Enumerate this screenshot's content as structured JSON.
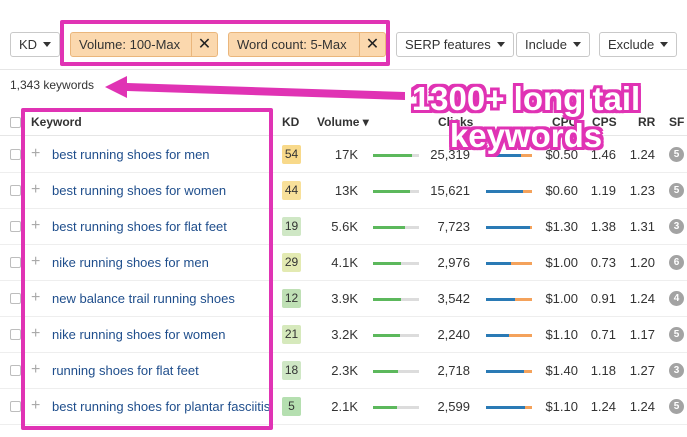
{
  "filters": {
    "kd_label": "KD",
    "chip_volume": "Volume: 100-Max",
    "chip_wordcount": "Word count: 5-Max",
    "chip_close": "✕",
    "serp_label": "SERP features",
    "include_label": "Include",
    "exclude_label": "Exclude"
  },
  "summary": {
    "count": "1,343 keywords"
  },
  "callout": {
    "line1": "1300+ long tail",
    "line2": "keywords"
  },
  "table": {
    "headers": {
      "keyword": "Keyword",
      "kd": "KD",
      "volume": "Volume ▾",
      "clicks": "Clicks",
      "cpc": "CPC",
      "cps": "CPS",
      "rr": "RR",
      "sf": "SF"
    },
    "rows": [
      {
        "keyword": "best running shoes for men",
        "kd": "54",
        "kd_color": "#f8d98a",
        "volume": "17K",
        "vol_fill": 0.85,
        "clicks": "25,319",
        "click_fill": 0.75,
        "cpc": "$0.50",
        "cps": "1.46",
        "rr": "1.24",
        "sf": "5"
      },
      {
        "keyword": "best running shoes for women",
        "kd": "44",
        "kd_color": "#f8e09a",
        "volume": "13K",
        "vol_fill": 0.8,
        "clicks": "15,621",
        "click_fill": 0.8,
        "cpc": "$0.60",
        "cps": "1.19",
        "rr": "1.23",
        "sf": "5"
      },
      {
        "keyword": "best running shoes for flat feet",
        "kd": "19",
        "kd_color": "#cfe7c5",
        "volume": "5.6K",
        "vol_fill": 0.7,
        "clicks": "7,723",
        "click_fill": 0.95,
        "cpc": "$1.30",
        "cps": "1.38",
        "rr": "1.31",
        "sf": "3"
      },
      {
        "keyword": "nike running shoes for men",
        "kd": "29",
        "kd_color": "#e3eab2",
        "volume": "4.1K",
        "vol_fill": 0.6,
        "clicks": "2,976",
        "click_fill": 0.55,
        "cpc": "$1.00",
        "cps": "0.73",
        "rr": "1.20",
        "sf": "6"
      },
      {
        "keyword": "new balance trail running shoes",
        "kd": "12",
        "kd_color": "#bfe0b5",
        "volume": "3.9K",
        "vol_fill": 0.6,
        "clicks": "3,542",
        "click_fill": 0.62,
        "cpc": "$1.00",
        "cps": "0.91",
        "rr": "1.24",
        "sf": "4"
      },
      {
        "keyword": "nike running shoes for women",
        "kd": "21",
        "kd_color": "#d6e9bc",
        "volume": "3.2K",
        "vol_fill": 0.58,
        "clicks": "2,240",
        "click_fill": 0.5,
        "cpc": "$1.10",
        "cps": "0.71",
        "rr": "1.17",
        "sf": "5"
      },
      {
        "keyword": "running shoes for flat feet",
        "kd": "18",
        "kd_color": "#cfe7c5",
        "volume": "2.3K",
        "vol_fill": 0.55,
        "clicks": "2,718",
        "click_fill": 0.82,
        "cpc": "$1.40",
        "cps": "1.18",
        "rr": "1.27",
        "sf": "3"
      },
      {
        "keyword": "best running shoes for plantar fasciitis",
        "kd": "5",
        "kd_color": "#b5dfb0",
        "volume": "2.1K",
        "vol_fill": 0.52,
        "clicks": "2,599",
        "click_fill": 0.85,
        "cpc": "$1.10",
        "cps": "1.24",
        "rr": "1.24",
        "sf": "5"
      }
    ]
  },
  "colors": {
    "highlight": "#e033b4",
    "chip_bg": "#fbd8ae",
    "link": "#1f4e8c",
    "volume_bar": "#5cb85c",
    "clicks_bar": "#2a7ab5",
    "clicks_bar_paid": "#f4a25b"
  }
}
